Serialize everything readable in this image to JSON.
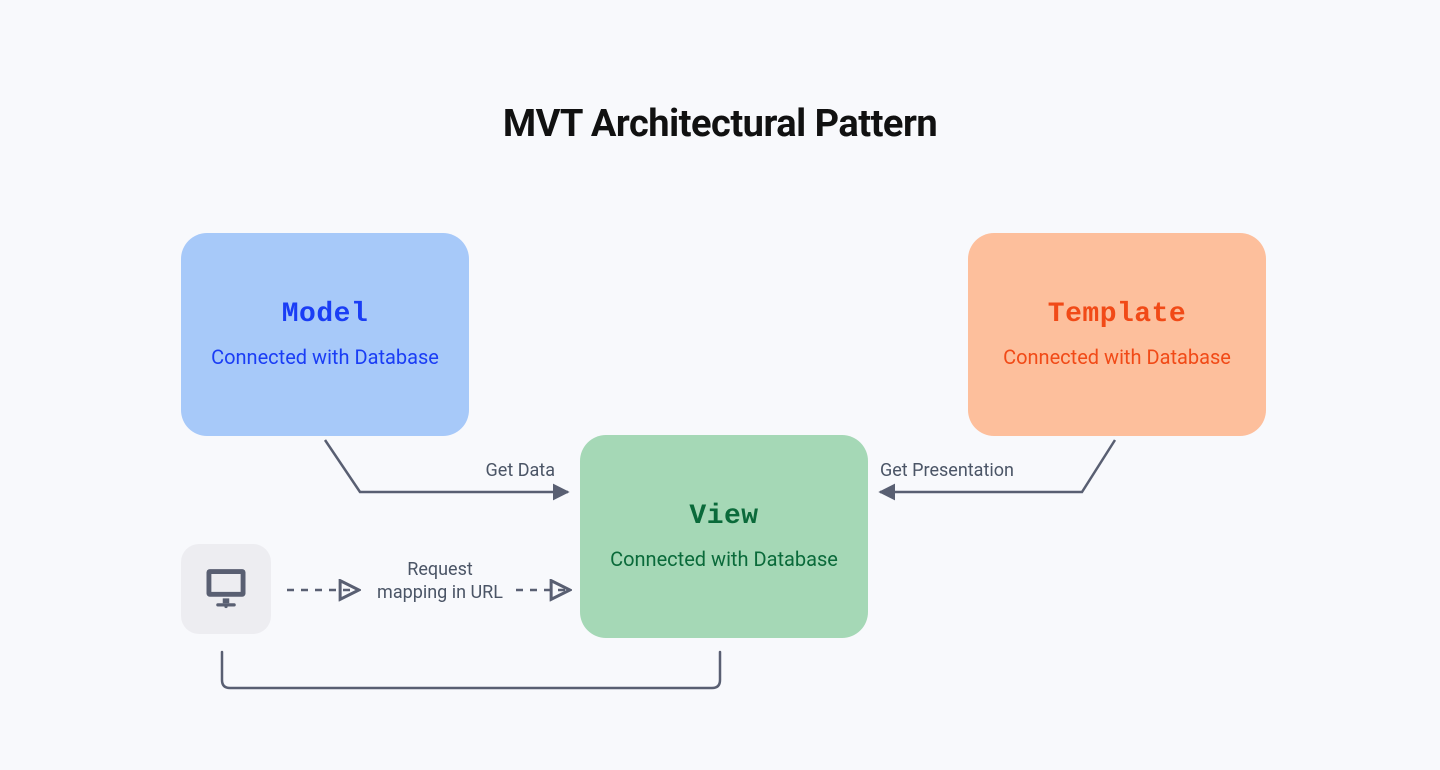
{
  "title": "MVT Architectural Pattern",
  "nodes": {
    "model": {
      "title": "Model",
      "subtitle": "Connected with Database"
    },
    "view": {
      "title": "View",
      "subtitle": "Connected with Database"
    },
    "template": {
      "title": "Template",
      "subtitle": "Connected with Database"
    },
    "client": {
      "icon": "computer-icon"
    }
  },
  "edges": {
    "model_to_view": {
      "label": "Get Data"
    },
    "template_to_view": {
      "label": "Get Presentation"
    },
    "client_to_view": {
      "label": "Request mapping in URL"
    },
    "client_view_loop": {
      "label": ""
    }
  },
  "colors": {
    "model_bg": "#a7c9f9",
    "model_fg": "#1a3df5",
    "template_bg": "#fdbf9c",
    "template_fg": "#f14a17",
    "view_bg": "#a5d8b6",
    "view_fg": "#0a6a3a",
    "client_bg": "#ededf1",
    "connector": "#595f72",
    "page_bg": "#f8f9fc"
  }
}
